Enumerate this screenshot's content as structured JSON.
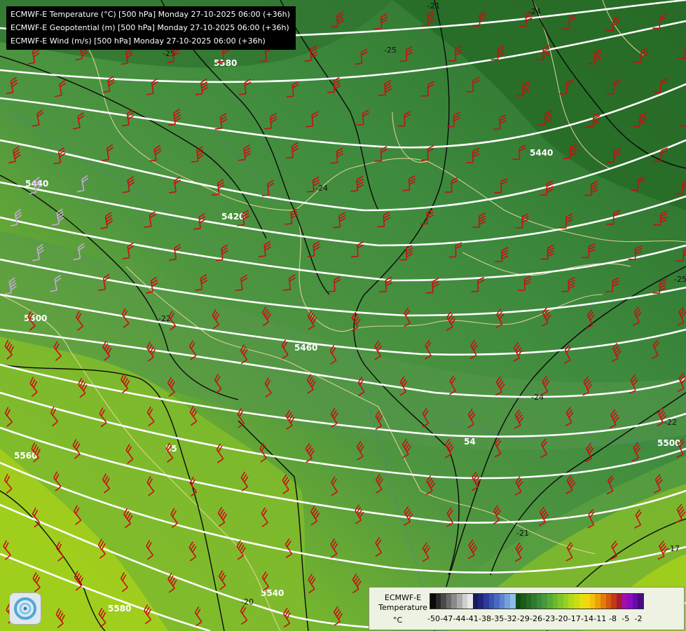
{
  "titles": [
    "ECMWF-E Temperature (°C) [500 hPa] Monday 27-10-2025 06:00 (+36h)",
    "ECMWF-E Geopotential (m) [500 hPa] Monday 27-10-2025 06:00 (+36h)",
    "ECMWF-E Wind (m/s) [500 hPa] Monday 27-10-2025 06:00 (+36h)"
  ],
  "legend": {
    "model": "ECMWF-E",
    "variable": "Temperature",
    "unit": "°C",
    "ticks": [
      "-50",
      "-47",
      "-44",
      "-41",
      "-38",
      "-35",
      "-32",
      "-29",
      "-26",
      "-23",
      "-20",
      "-17",
      "-14",
      "-11",
      "-8",
      "-5",
      "-2"
    ],
    "colors": [
      "#0a0a0a",
      "#2a2a2a",
      "#4a4a4a",
      "#6a6a6a",
      "#8a8a8a",
      "#aaaaaa",
      "#cfcfcf",
      "#e8e8e8",
      "#1a1a5a",
      "#22247a",
      "#2c3a9a",
      "#3a52b0",
      "#4a6ac2",
      "#5c84d0",
      "#74a0dc",
      "#8ebce6",
      "#0f4a0f",
      "#1a5a1a",
      "#246a24",
      "#2e7a2e",
      "#3a8a3a",
      "#469a3a",
      "#56aa36",
      "#6ab82e",
      "#7ec62a",
      "#98d022",
      "#b2da1a",
      "#ccdc14",
      "#e2e010",
      "#f0d80c",
      "#f4c00a",
      "#eea008",
      "#e27c08",
      "#d25a10",
      "#c03a1a",
      "#a81c2a",
      "#a010a8",
      "#8a0cc0",
      "#6a0aa8",
      "#4a0a80"
    ]
  },
  "isohypse_labels": [
    "5380",
    "5440",
    "5420",
    "5500",
    "5460",
    "5440",
    "5500",
    "5560",
    "5580",
    "5540",
    "55",
    "54"
  ],
  "isotherm_labels": [
    "-25",
    "-24",
    "-25",
    "-24",
    "-22",
    "-22",
    "-21",
    "-20",
    "-17",
    "-24",
    "-21",
    "-25"
  ],
  "colors": {
    "isohypse": "#ffffff",
    "isotherm": "#0a0a0a",
    "wind_barb": "#c81010",
    "border": "#e8d89a"
  },
  "logo": "ecmwf-swirl-icon"
}
